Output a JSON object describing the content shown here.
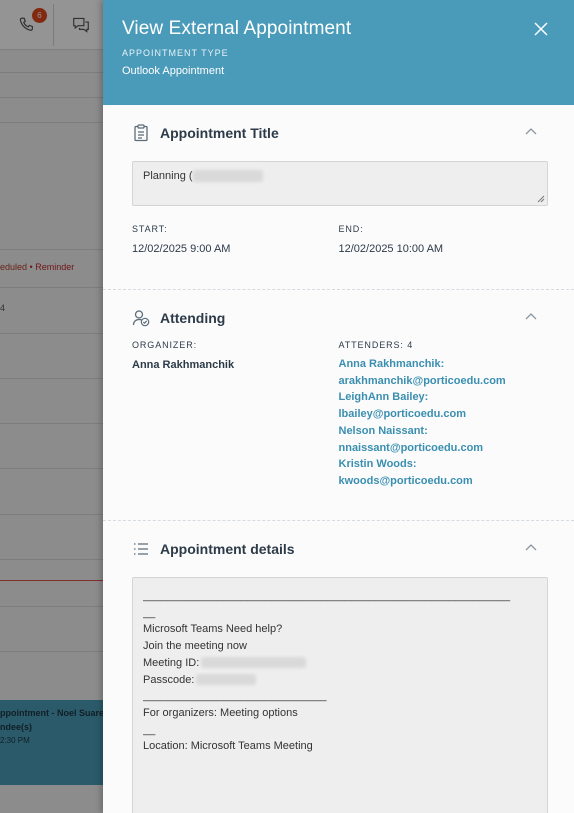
{
  "background": {
    "phone_badge": "6",
    "status_scheduled": "eduled",
    "status_dot": "•",
    "status_reminder": "Reminder",
    "row_number": "4",
    "event_title": "ppointment - Noel Suarez",
    "event_attendees": "ndee(s)",
    "event_time": "2:30 PM"
  },
  "panel": {
    "title": "View External Appointment",
    "type_label": "APPOINTMENT TYPE",
    "type_value": "Outlook Appointment"
  },
  "appointment_title": {
    "heading": "Appointment Title",
    "value_visible": "Planning (",
    "start_label": "START:",
    "start_value": "12/02/2025 9:00 AM",
    "end_label": "END:",
    "end_value": "12/02/2025 10:00 AM"
  },
  "attending": {
    "heading": "Attending",
    "organizer_label": "ORGANIZER:",
    "organizer_name": "Anna Rakhmanchik",
    "attenders_label": "ATTENDERS: 4",
    "attenders": [
      {
        "name": "Anna Rakhmanchik:",
        "email": "arakhmanchik@porticoedu.com"
      },
      {
        "name": "LeighAnn Bailey:",
        "email": "lbailey@porticoedu.com"
      },
      {
        "name": "Nelson Naissant:",
        "email": "nnaissant@porticoedu.com"
      },
      {
        "name": "Kristin Woods:",
        "email": "kwoods@porticoedu.com"
      }
    ]
  },
  "details": {
    "heading": "Appointment details",
    "line1": "____________________________________________________________",
    "line2": "__",
    "line3": "Microsoft Teams Need help?",
    "line4": "Join the meeting now",
    "line5": "Meeting ID:",
    "line6": "Passcode:",
    "line7": "______________________________",
    "line8": "For organizers: Meeting options",
    "line9": "__",
    "line10": "Location: Microsoft Teams Meeting"
  },
  "colors": {
    "header_bg": "#4a9ab9",
    "link": "#3a8fb0",
    "badge": "#e0471b"
  }
}
